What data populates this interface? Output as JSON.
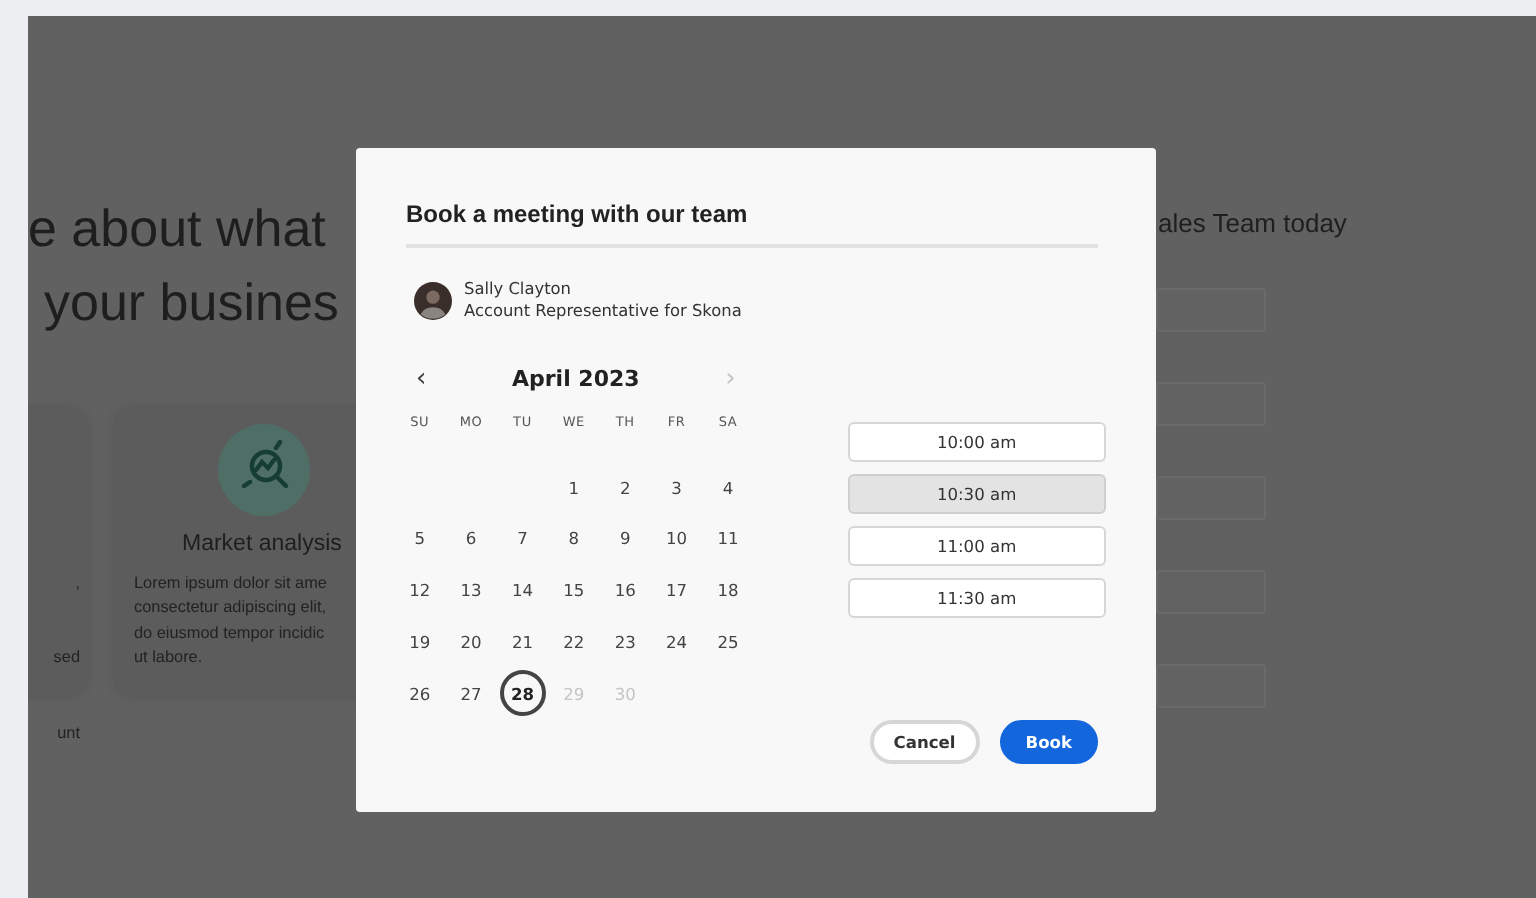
{
  "background_page": {
    "heading_lines": [
      "e about what",
      "your busines"
    ],
    "cards": [
      {
        "lines": [
          ",",
          "sed",
          "unt"
        ]
      },
      {
        "title": "Market analysis",
        "lines": [
          "Lorem ipsum dolor sit ame",
          "consectetur adipiscing elit,",
          "do eiusmod tempor incidic",
          "ut labore."
        ]
      }
    ],
    "form_title": "ales Team today"
  },
  "dialog": {
    "title": "Book a meeting with our team",
    "person": {
      "name": "Sally Clayton",
      "role": "Account Representative for Skona"
    },
    "calendar": {
      "month": "April 2023",
      "prev": "‹",
      "next": "›",
      "prev_disabled": false,
      "next_disabled": true,
      "weekdays": [
        "SU",
        "MO",
        "TU",
        "WE",
        "TH",
        "FR",
        "SA"
      ],
      "weeks": [
        [
          {
            "day": "1",
            "selected": false,
            "disabled": false
          },
          {
            "day": "2",
            "selected": false,
            "disabled": false
          },
          {
            "day": "3",
            "selected": false,
            "disabled": false
          },
          {
            "day": "4",
            "selected": false,
            "disabled": false
          }
        ],
        [
          {
            "day": "5",
            "selected": false,
            "disabled": false
          },
          {
            "day": "6",
            "selected": false,
            "disabled": false
          },
          {
            "day": "7",
            "selected": false,
            "disabled": false
          },
          {
            "day": "8",
            "selected": false,
            "disabled": false
          },
          {
            "day": "9",
            "selected": false,
            "disabled": false
          },
          {
            "day": "10",
            "selected": false,
            "disabled": false
          },
          {
            "day": "11",
            "selected": false,
            "disabled": false
          }
        ],
        [
          {
            "day": "12",
            "selected": false,
            "disabled": false
          },
          {
            "day": "13",
            "selected": false,
            "disabled": false
          },
          {
            "day": "14",
            "selected": false,
            "disabled": false
          },
          {
            "day": "15",
            "selected": false,
            "disabled": false
          },
          {
            "day": "16",
            "selected": false,
            "disabled": false
          },
          {
            "day": "17",
            "selected": false,
            "disabled": false
          },
          {
            "day": "18",
            "selected": false,
            "disabled": false
          }
        ],
        [
          {
            "day": "19",
            "selected": false,
            "disabled": false
          },
          {
            "day": "20",
            "selected": false,
            "disabled": false
          },
          {
            "day": "21",
            "selected": false,
            "disabled": false
          },
          {
            "day": "22",
            "selected": false,
            "disabled": false
          },
          {
            "day": "23",
            "selected": false,
            "disabled": false
          },
          {
            "day": "24",
            "selected": false,
            "disabled": false
          },
          {
            "day": "25",
            "selected": false,
            "disabled": false
          }
        ],
        [
          {
            "day": "26",
            "selected": false,
            "disabled": false
          },
          {
            "day": "27",
            "selected": false,
            "disabled": false
          },
          {
            "day": "28",
            "selected": true,
            "disabled": false
          },
          {
            "day": "29",
            "selected": false,
            "disabled": true
          },
          {
            "day": "30",
            "selected": false,
            "disabled": true
          }
        ]
      ]
    },
    "times": [
      {
        "label": "10:00 am",
        "selected": false
      },
      {
        "label": "10:30 am",
        "selected": true
      },
      {
        "label": "11:00 am",
        "selected": false
      },
      {
        "label": "11:30 am",
        "selected": false
      }
    ],
    "buttons": [
      {
        "label": "Cancel",
        "kind": "secondary"
      },
      {
        "label": "Book",
        "kind": "primary"
      }
    ]
  }
}
